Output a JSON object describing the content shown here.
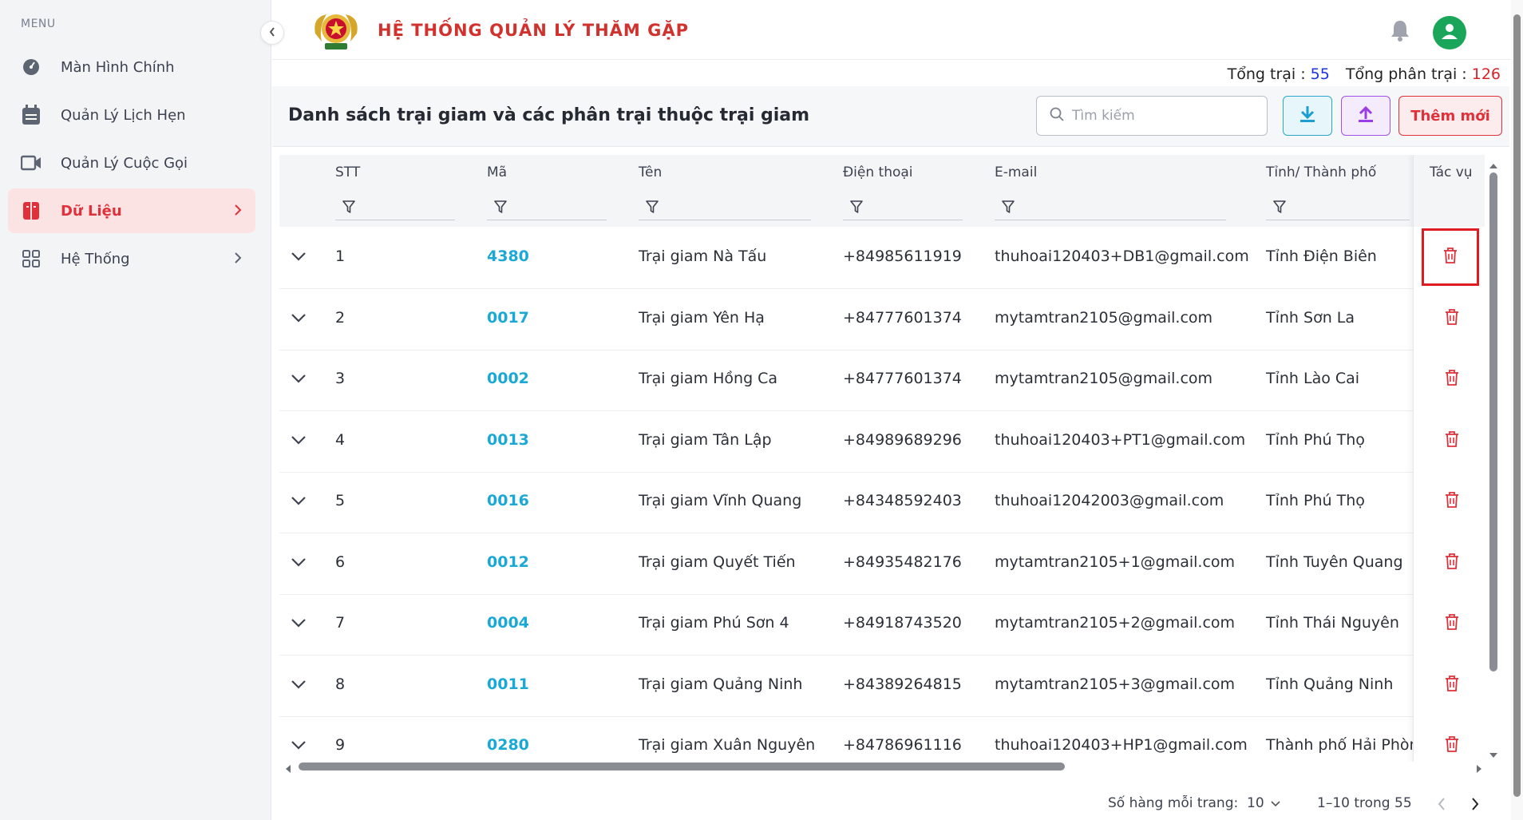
{
  "sidebar": {
    "menu_label": "MENU",
    "items": [
      {
        "label": "Màn Hình Chính",
        "icon": "dashboard-gauge-icon"
      },
      {
        "label": "Quản Lý Lịch Hẹn",
        "icon": "calendar-icon"
      },
      {
        "label": "Quản Lý Cuộc Gọi",
        "icon": "video-camera-icon"
      },
      {
        "label": "Dữ Liệu",
        "icon": "database-icon",
        "active": true
      },
      {
        "label": "Hệ Thống",
        "icon": "grid-apps-icon"
      }
    ]
  },
  "header": {
    "title": "HỆ THỐNG QUẢN LÝ THĂM GẶP"
  },
  "totals": {
    "camps_label": "Tổng trại :",
    "camps_value": "55",
    "subcamps_label": "Tổng phân trại :",
    "subcamps_value": "126"
  },
  "toolbar": {
    "page_title": "Danh sách trại giam và các phân trại thuộc trại giam",
    "search_placeholder": "Tìm kiếm",
    "add_label": "Thêm mới"
  },
  "table": {
    "columns": [
      "STT",
      "Mã",
      "Tên",
      "Điện thoại",
      "E-mail",
      "Tỉnh/ Thành phố"
    ],
    "actions_header": "Tác vụ",
    "rows": [
      {
        "stt": "1",
        "code": "4380",
        "name": "Trại giam Nà Tấu",
        "phone": "+84985611919",
        "email": "thuhoai120403+DB1@gmail.com",
        "province": "Tỉnh Điện Biên"
      },
      {
        "stt": "2",
        "code": "0017",
        "name": "Trại giam Yên Hạ",
        "phone": "+84777601374",
        "email": "mytamtran2105@gmail.com",
        "province": "Tỉnh Sơn La"
      },
      {
        "stt": "3",
        "code": "0002",
        "name": "Trại giam Hồng Ca",
        "phone": "+84777601374",
        "email": "mytamtran2105@gmail.com",
        "province": "Tỉnh Lào Cai"
      },
      {
        "stt": "4",
        "code": "0013",
        "name": "Trại giam Tân Lập",
        "phone": "+84989689296",
        "email": "thuhoai120403+PT1@gmail.com",
        "province": "Tỉnh Phú Thọ"
      },
      {
        "stt": "5",
        "code": "0016",
        "name": "Trại giam Vĩnh Quang",
        "phone": "+84348592403",
        "email": "thuhoai12042003@gmail.com",
        "province": "Tỉnh Phú Thọ"
      },
      {
        "stt": "6",
        "code": "0012",
        "name": "Trại giam Quyết Tiến",
        "phone": "+84935482176",
        "email": "mytamtran2105+1@gmail.com",
        "province": "Tỉnh Tuyên Quang"
      },
      {
        "stt": "7",
        "code": "0004",
        "name": "Trại giam Phú Sơn 4",
        "phone": "+84918743520",
        "email": "mytamtran2105+2@gmail.com",
        "province": "Tỉnh Thái Nguyên"
      },
      {
        "stt": "8",
        "code": "0011",
        "name": "Trại giam Quảng Ninh",
        "phone": "+84389264815",
        "email": "mytamtran2105+3@gmail.com",
        "province": "Tỉnh Quảng Ninh"
      },
      {
        "stt": "9",
        "code": "0280",
        "name": "Trại giam Xuân Nguyên",
        "phone": "+84786961116",
        "email": "thuhoai120403+HP1@gmail.com",
        "province": "Thành phố Hải Phòn"
      }
    ]
  },
  "pagination": {
    "rows_per_page_label": "Số hàng mỗi trang:",
    "rows_per_page_value": "10",
    "range": "1–10 trong 55"
  },
  "colors": {
    "accent_red": "#e0313a",
    "code_blue": "#1aa9d6",
    "title_red": "#d1322e",
    "avatar_green": "#1aa65a"
  }
}
